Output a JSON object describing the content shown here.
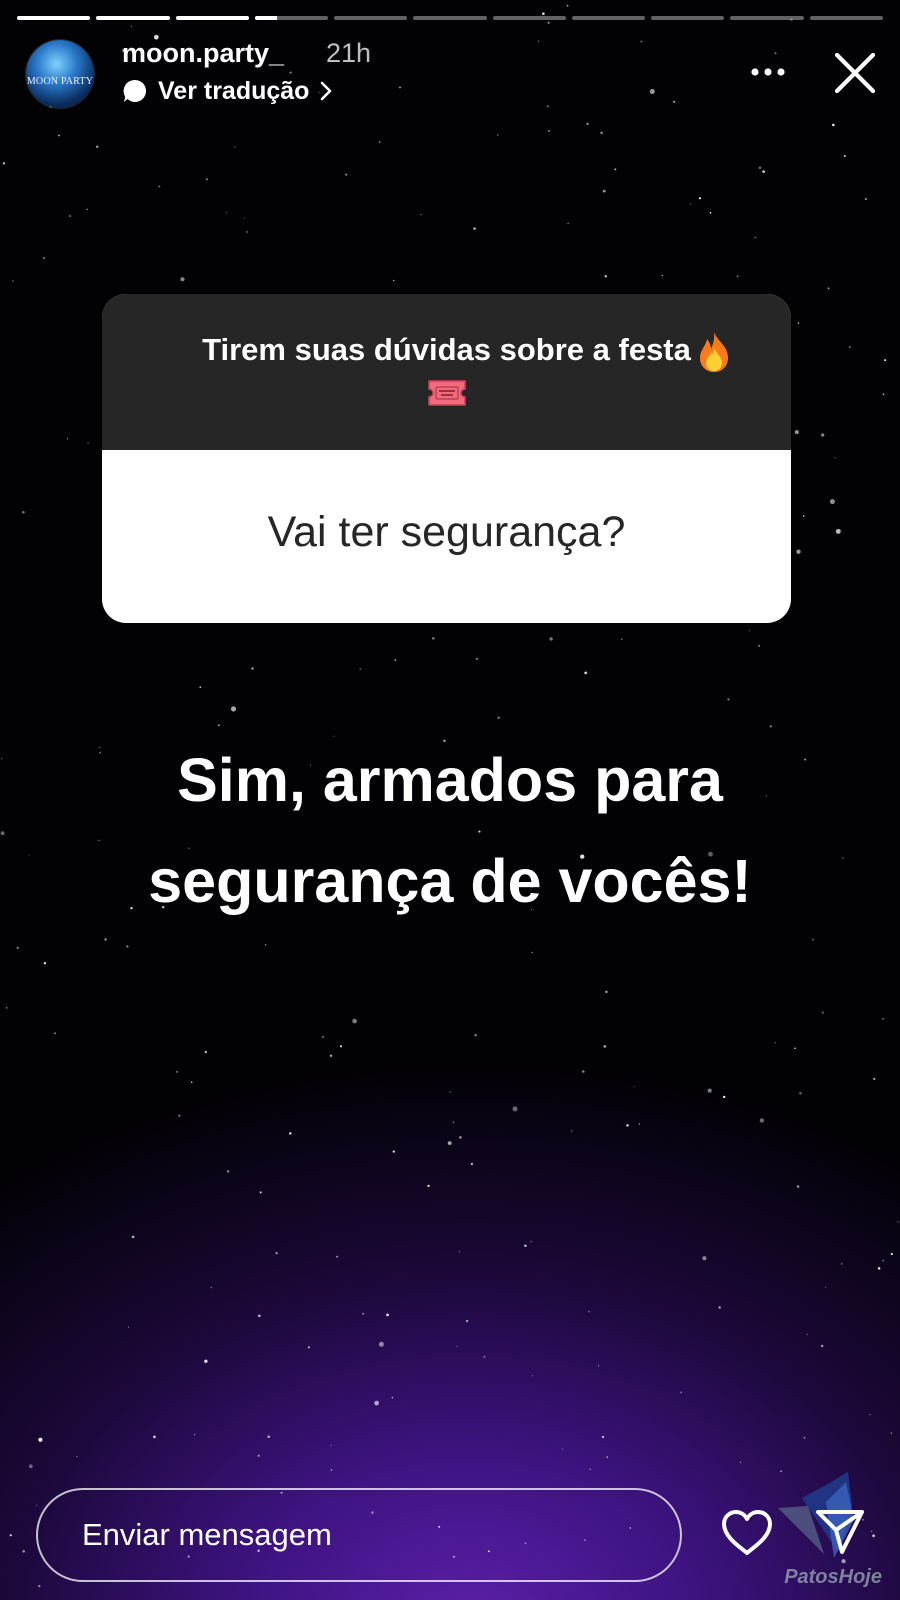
{
  "story": {
    "progress": {
      "segments": 11,
      "active_index": 3,
      "active_fraction": 0.3
    }
  },
  "header": {
    "avatar_text": "MOON PARTY",
    "username": "moon.party_",
    "time": "21h",
    "translate_label": "Ver tradução",
    "icons": {
      "translate": "speech-bubble-icon",
      "translate_chevron": "chevron-right-icon",
      "more": "more-horizontal-icon",
      "close": "close-icon"
    }
  },
  "question_sticker": {
    "prompt": "Tirem suas dúvidas sobre a festa",
    "prompt_emojis": [
      "fire-icon",
      "ticket-icon"
    ],
    "answer": "Vai ter segurança?",
    "colors": {
      "header": "#262626",
      "body": "#ffffff",
      "answer_text": "#262626"
    }
  },
  "reply": {
    "lines": [
      "Sim, armados para",
      "segurança de vocês!"
    ]
  },
  "footer": {
    "message_placeholder": "Enviar mensagem",
    "icons": {
      "like": "heart-icon",
      "send": "paper-plane-icon"
    }
  },
  "watermark": {
    "text": "PatosHoje"
  },
  "colors": {
    "background": "#020104",
    "glow": "#5a1fa8",
    "text": "#ffffff"
  }
}
